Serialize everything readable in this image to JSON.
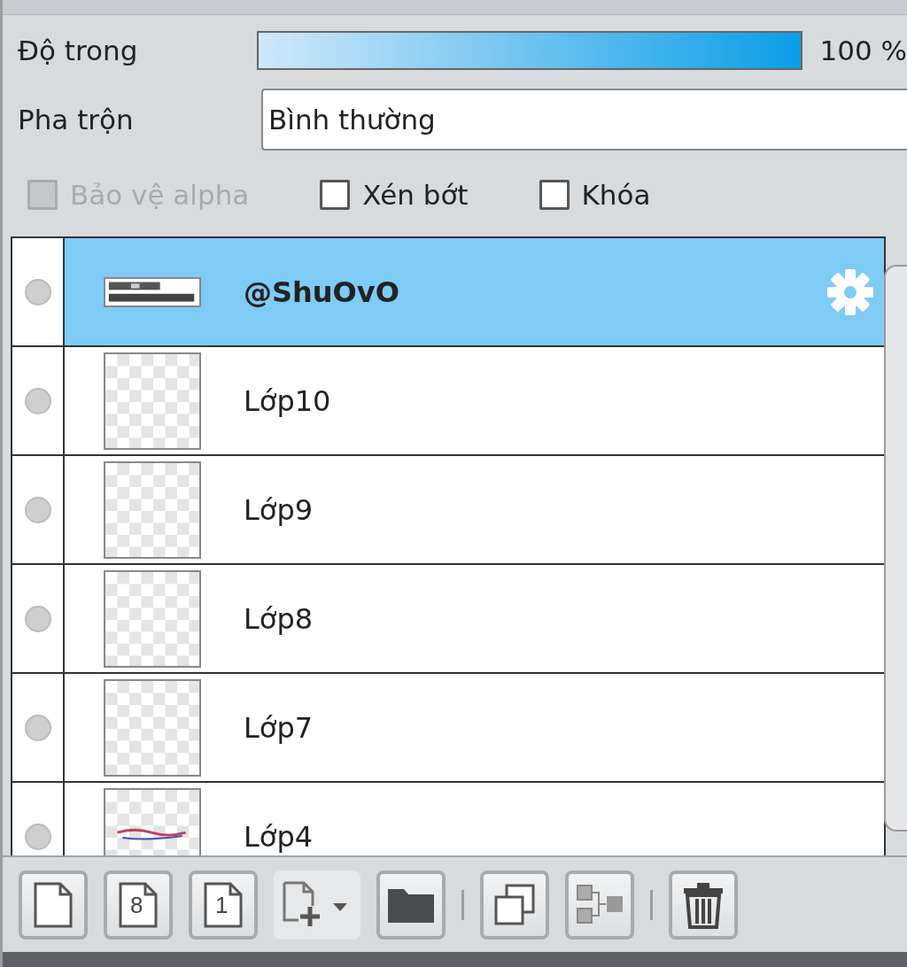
{
  "opacity": {
    "label": "Độ trong",
    "level": 1,
    "reading": "100 %"
  },
  "blend": {
    "label": "Pha trộn",
    "value": "Bình thường"
  },
  "options": [
    {
      "label": "Bảo vệ alpha",
      "checked": false,
      "disabled": true
    },
    {
      "label": "Xén bớt",
      "checked": false,
      "disabled": false
    },
    {
      "label": "Khóa",
      "checked": false,
      "disabled": false
    }
  ],
  "layers": [
    {
      "name": "@ShuOvO",
      "selected": true
    },
    {
      "name": "Lớp10",
      "selected": false
    },
    {
      "name": "Lớp9",
      "selected": false
    },
    {
      "name": "Lớp8",
      "selected": false
    },
    {
      "name": "Lớp7",
      "selected": false
    },
    {
      "name": "Lớp4",
      "selected": false
    }
  ],
  "toolbar": [
    {
      "kind": "page"
    },
    {
      "kind": "page",
      "glyph": "8"
    },
    {
      "kind": "page",
      "glyph": "1"
    },
    {
      "kind": "add"
    },
    {
      "kind": "folder"
    },
    {
      "kind": "separator"
    },
    {
      "kind": "duplicate"
    },
    {
      "kind": "transfer"
    },
    {
      "kind": "separator"
    },
    {
      "kind": "trash"
    }
  ]
}
